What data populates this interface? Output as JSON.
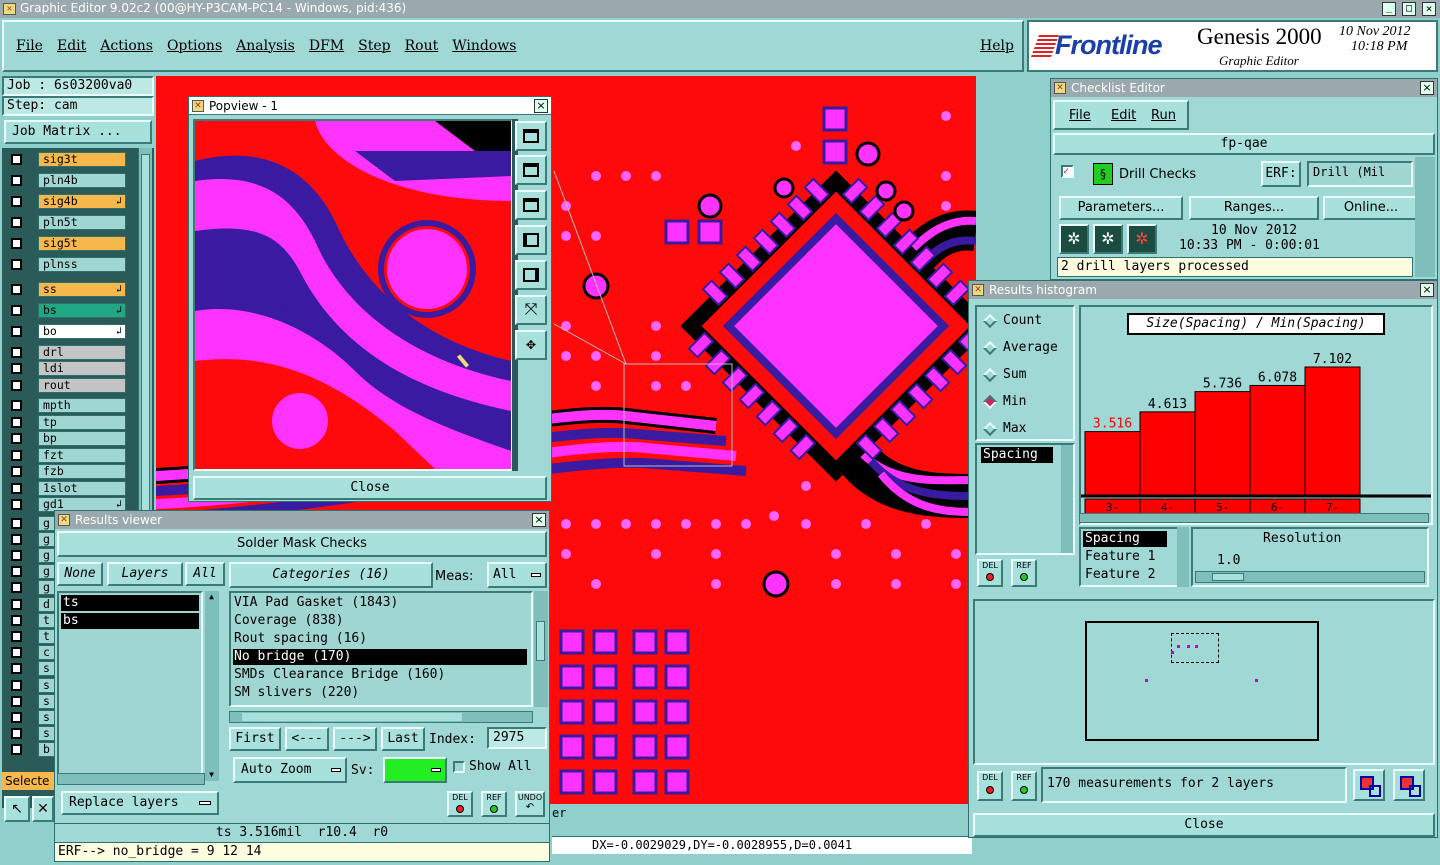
{
  "app_title": "Graphic Editor 9.02c2 (00@HY-P3CAM-PC14 - Windows, pid:436)",
  "menu": [
    "File",
    "Edit",
    "Actions",
    "Options",
    "Analysis",
    "DFM",
    "Step",
    "Rout",
    "Windows"
  ],
  "help": "Help",
  "brand": {
    "logo": "Frontline",
    "product": "Genesis 2000",
    "subtitle": "Graphic Editor",
    "date": "10 Nov 2012",
    "time": "10:18 PM"
  },
  "job": {
    "job": "Job : 6s03200va0",
    "step": "Step: cam",
    "matrix": "Job Matrix ..."
  },
  "layers": [
    {
      "name": "sig3t",
      "color": "#f6b84a"
    },
    {
      "name": "pln4b",
      "color": "#9fd6d2"
    },
    {
      "name": "sig4b",
      "color": "#f6b84a",
      "mark": "↲"
    },
    {
      "name": "pln5t",
      "color": "#9fd6d2"
    },
    {
      "name": "sig5t",
      "color": "#f6b84a"
    },
    {
      "name": "plnss",
      "color": "#9fd6d2"
    },
    {
      "name": "ss",
      "color": "#f6b84a",
      "mark": "↲"
    },
    {
      "name": "bs",
      "color": "#1fa882",
      "mark": "↲"
    },
    {
      "name": "bo",
      "color": "#ffffff",
      "mark": "↲"
    },
    {
      "name": "drl",
      "color": "#c4c4c4"
    },
    {
      "name": "ldi",
      "color": "#c4c4c4"
    },
    {
      "name": "rout",
      "color": "#c4c4c4"
    },
    {
      "name": "mpth",
      "color": "#9fd6d2"
    },
    {
      "name": "tp",
      "color": "#9fd6d2"
    },
    {
      "name": "bp",
      "color": "#9fd6d2"
    },
    {
      "name": "fzt",
      "color": "#9fd6d2"
    },
    {
      "name": "fzb",
      "color": "#9fd6d2"
    },
    {
      "name": "1slot",
      "color": "#9fd6d2"
    },
    {
      "name": "gd1",
      "color": "#9fd6d2",
      "mark": "↲"
    }
  ],
  "left_truncated": [
    "g",
    "g",
    "g",
    "g",
    "g",
    "d",
    "t",
    "t",
    "c",
    "s",
    "s",
    "s",
    "s",
    "s",
    "b"
  ],
  "selected_label": "Selecte",
  "popview": {
    "title": "Popview - 1",
    "close": "Close"
  },
  "checklist": {
    "title": "Checklist Editor",
    "menu": [
      "File",
      "Edit",
      "Run"
    ],
    "name": "fp-qae",
    "check": "Drill Checks",
    "erf_btn": "ERF:",
    "erf_val": "Drill (Mil",
    "params": "Parameters...",
    "ranges": "Ranges...",
    "online": "Online...",
    "date": "10 Nov 2012",
    "time": "10:33 PM - 0:00:01",
    "status": "2 drill layers processed"
  },
  "histogram": {
    "title": "Results histogram",
    "modes": [
      "Count",
      "Average",
      "Sum",
      "Min",
      "Max"
    ],
    "selected_mode": "Min",
    "list": [
      "Spacing"
    ],
    "chart_title": "Size(Spacing) / Min(Spacing)",
    "res_title": "Resolution",
    "res_value": "1.0",
    "attrs": [
      "Spacing",
      "Feature 1",
      "Feature 2"
    ],
    "summary": "170 measurements for 2 layers",
    "close": "Close",
    "del": "DEL",
    "ref": "REF"
  },
  "chart_data": {
    "type": "bar",
    "title": "Size(Spacing) / Min(Spacing)",
    "categories": [
      "3-4",
      "4-5",
      "5-6",
      "6-7",
      "7-8"
    ],
    "cat_top": [
      "3-",
      "4-",
      "5-",
      "6-",
      "7-"
    ],
    "cat_bot": [
      "4",
      "5",
      "6",
      "7",
      "8"
    ],
    "values": [
      3.516,
      4.613,
      5.736,
      6.078,
      7.102
    ],
    "labels": [
      "3.516",
      "4.613",
      "5.736",
      "6.078",
      "7.102"
    ],
    "bar_color": "#ff0000",
    "highlight_color": "#ff0000"
  },
  "results": {
    "title": "Results viewer",
    "header": "Solder Mask Checks",
    "none": "None",
    "layers_btn": "Layers",
    "all": "All",
    "layers": [
      "ts",
      "bs"
    ],
    "categories_label": "Categories (16)",
    "meas_label": "Meas:",
    "meas_value": "All",
    "categories": [
      {
        "label": "VIA Pad Gasket (1843)"
      },
      {
        "label": "Coverage (838)"
      },
      {
        "label": "Rout spacing (16)"
      },
      {
        "label": "No bridge (170)",
        "selected": true
      },
      {
        "label": "SMDs Clearance Bridge (160)"
      },
      {
        "label": "SM slivers (220)"
      }
    ],
    "first": "First",
    "prev": "<---",
    "next": "--->",
    "last": "Last",
    "index_label": "Index:",
    "index_value": "2975",
    "auto_zoom": "Auto Zoom",
    "sv_label": "Sv:",
    "show_all": "Show All",
    "replace": "Replace layers",
    "del": "DEL",
    "ref": "REF",
    "undo": "UNDO",
    "measure": "ts 3.516mil  r10.4  r0",
    "erf_line": "ERF--> no_bridge = 9 12 14"
  },
  "status_coords": "DX=-0.0029029,DY=-0.0028955,D=0.0041",
  "status_partial": "er"
}
